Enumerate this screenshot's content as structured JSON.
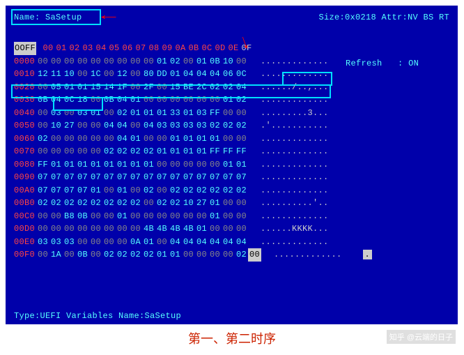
{
  "header": {
    "name_label": "Name: SaSetup",
    "size_attr": "Size:0x0218 Attr:NV BS RT"
  },
  "grid": {
    "corner": "OOFF",
    "col_headers": [
      "00",
      "01",
      "02",
      "03",
      "04",
      "05",
      "06",
      "07",
      "08",
      "09",
      "0A",
      "0B",
      "0C",
      "0D",
      "0E",
      "0F"
    ],
    "rows": [
      {
        "offset": "0000",
        "cells": [
          "00",
          "00",
          "00",
          "00",
          "00",
          "00",
          "00",
          "00",
          "00",
          "01",
          "02",
          "00",
          "01",
          "0B",
          "10",
          "00"
        ],
        "ascii": "............."
      },
      {
        "offset": "0010",
        "cells": [
          "12",
          "11",
          "10",
          "00",
          "1C",
          "00",
          "12",
          "00",
          "80",
          "DD",
          "01",
          "04",
          "04",
          "04",
          "06",
          "0C"
        ],
        "ascii": "............."
      },
      {
        "offset": "0020",
        "cells": [
          "00",
          "05",
          "01",
          "01",
          "15",
          "14",
          "1F",
          "00",
          "2F",
          "00",
          "15",
          "BE",
          "2C",
          "02",
          "02",
          "04"
        ],
        "ascii": "....../..,..."
      },
      {
        "offset": "0030",
        "cells": [
          "0B",
          "04",
          "0C",
          "18",
          "00",
          "0B",
          "04",
          "01",
          "00",
          "00",
          "00",
          "00",
          "00",
          "00",
          "01",
          "02"
        ],
        "ascii": "............."
      },
      {
        "offset": "0040",
        "cells": [
          "00",
          "03",
          "00",
          "03",
          "01",
          "00",
          "02",
          "01",
          "01",
          "01",
          "33",
          "01",
          "03",
          "FF",
          "00",
          "00"
        ],
        "ascii": ".........3..."
      },
      {
        "offset": "0050",
        "cells": [
          "00",
          "10",
          "27",
          "00",
          "00",
          "04",
          "04",
          "00",
          "04",
          "03",
          "03",
          "03",
          "03",
          "02",
          "02",
          "02"
        ],
        "ascii": ".'..........."
      },
      {
        "offset": "0060",
        "cells": [
          "02",
          "00",
          "00",
          "00",
          "00",
          "00",
          "04",
          "01",
          "00",
          "00",
          "01",
          "01",
          "01",
          "01",
          "00",
          "00"
        ],
        "ascii": "............."
      },
      {
        "offset": "0070",
        "cells": [
          "00",
          "00",
          "00",
          "00",
          "00",
          "02",
          "02",
          "02",
          "02",
          "01",
          "01",
          "01",
          "01",
          "FF",
          "FF",
          "FF"
        ],
        "ascii": "............."
      },
      {
        "offset": "0080",
        "cells": [
          "FF",
          "01",
          "01",
          "01",
          "01",
          "01",
          "01",
          "01",
          "01",
          "00",
          "00",
          "00",
          "00",
          "00",
          "01",
          "01"
        ],
        "ascii": "............."
      },
      {
        "offset": "0090",
        "cells": [
          "07",
          "07",
          "07",
          "07",
          "07",
          "07",
          "07",
          "07",
          "07",
          "07",
          "07",
          "07",
          "07",
          "07",
          "07",
          "07"
        ],
        "ascii": "............."
      },
      {
        "offset": "00A0",
        "cells": [
          "07",
          "07",
          "07",
          "07",
          "01",
          "00",
          "01",
          "00",
          "02",
          "00",
          "02",
          "02",
          "02",
          "02",
          "02",
          "02"
        ],
        "ascii": "............."
      },
      {
        "offset": "00B0",
        "cells": [
          "02",
          "02",
          "02",
          "02",
          "02",
          "02",
          "02",
          "02",
          "00",
          "02",
          "02",
          "10",
          "27",
          "01",
          "00",
          "00"
        ],
        "ascii": "..........'.."
      },
      {
        "offset": "00C0",
        "cells": [
          "00",
          "00",
          "B8",
          "0B",
          "00",
          "00",
          "01",
          "00",
          "00",
          "00",
          "00",
          "00",
          "00",
          "01",
          "00",
          "00"
        ],
        "ascii": "............."
      },
      {
        "offset": "00D0",
        "cells": [
          "00",
          "00",
          "00",
          "00",
          "00",
          "00",
          "00",
          "00",
          "4B",
          "4B",
          "4B",
          "4B",
          "01",
          "00",
          "00",
          "00"
        ],
        "ascii": "......KKKK..."
      },
      {
        "offset": "00E0",
        "cells": [
          "03",
          "03",
          "03",
          "00",
          "00",
          "00",
          "00",
          "0A",
          "01",
          "00",
          "04",
          "04",
          "04",
          "04",
          "04",
          "04"
        ],
        "ascii": "............."
      },
      {
        "offset": "00F0",
        "cells": [
          "00",
          "1A",
          "00",
          "0B",
          "00",
          "02",
          "02",
          "02",
          "02",
          "01",
          "01",
          "00",
          "00",
          "00",
          "00",
          "02"
        ],
        "ascii": ".............",
        "trail_hilite": "00",
        "trail_ascii": "."
      }
    ]
  },
  "side": {
    "refresh_label": "Refresh",
    "refresh_sep": ":",
    "refresh_value": "ON"
  },
  "footer": {
    "text": "Type:UEFI Variables  Name:SaSetup"
  },
  "caption": "第一、第二时序",
  "watermark": "知乎 @云端的日子"
}
